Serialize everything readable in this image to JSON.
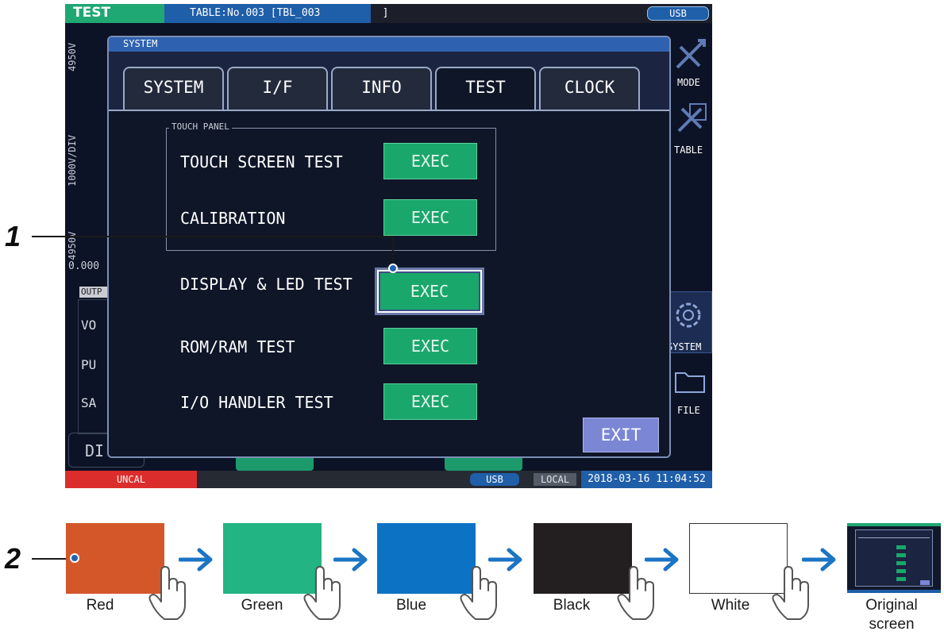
{
  "device_screen": {
    "top_bar": {
      "mode": "TEST",
      "table": "TABLE:No.003 [TBL_003          ]",
      "usb": "USB"
    },
    "background": {
      "axis_labels": [
        "4950V",
        "1000V/DIV",
        "-4950V"
      ],
      "time_label": "0.000",
      "output_header": "OUTP",
      "output_rows": [
        "VO",
        "PU",
        "SA"
      ],
      "bottom_left_button": "DI",
      "right_menu": [
        "MODE",
        "TABLE",
        "SYSTEM",
        "FILE"
      ]
    },
    "bottom_bar": {
      "status": "UNCAL",
      "usb": "USB",
      "local": "LOCAL",
      "datetime": "2018-03-16 11:04:52"
    },
    "dialog": {
      "title": "SYSTEM",
      "tabs": [
        {
          "label": "SYSTEM",
          "active": false
        },
        {
          "label": "I/F",
          "active": false
        },
        {
          "label": "INFO",
          "active": false
        },
        {
          "label": "TEST",
          "active": true
        },
        {
          "label": "CLOCK",
          "active": false
        }
      ],
      "touch_panel_group": "TOUCH PANEL",
      "tests": [
        {
          "label": "TOUCH SCREEN TEST",
          "button": "EXEC"
        },
        {
          "label": "CALIBRATION",
          "button": "EXEC"
        },
        {
          "label": "DISPLAY & LED TEST",
          "button": "EXEC",
          "highlighted": true
        },
        {
          "label": "ROM/RAM TEST",
          "button": "EXEC"
        },
        {
          "label": "I/O HANDLER TEST",
          "button": "EXEC"
        }
      ],
      "exit_label": "EXIT"
    }
  },
  "annotations": {
    "step1": "1",
    "step2": "2"
  },
  "color_sequence": [
    {
      "label": "Red",
      "color": "#d4572a"
    },
    {
      "label": "Green",
      "color": "#22b482"
    },
    {
      "label": "Blue",
      "color": "#0c73c4"
    },
    {
      "label": "Black",
      "color": "#231f20"
    },
    {
      "label": "White",
      "color": "#ffffff"
    },
    {
      "label": "Original screen",
      "line1": "Original",
      "line2": "screen"
    }
  ]
}
